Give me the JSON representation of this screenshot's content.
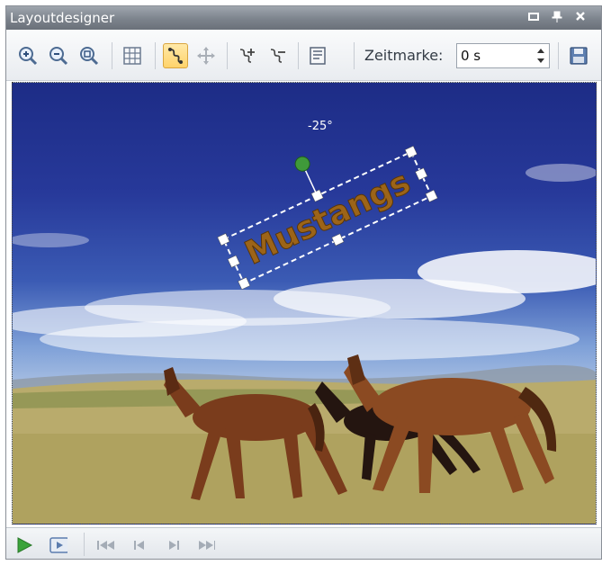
{
  "window": {
    "title": "Layoutdesigner"
  },
  "toolbar": {
    "zeit_label": "Zeitmarke:",
    "zeit_value": "0 s"
  },
  "canvas": {
    "text_object": "Mustangs",
    "rotation_label": "-25°"
  },
  "colors": {
    "titlebar": "#7c838c",
    "text_fill": "#9c6418",
    "active_tool": "#ffd36b",
    "play_green": "#3aa33a"
  },
  "icons": {
    "zoom_in": "magnifier-plus-icon",
    "zoom_out": "magnifier-minus-icon",
    "zoom_fit": "magnifier-fit-icon",
    "grid": "grid-icon",
    "motion_path": "motion-path-icon",
    "move": "move-arrows-icon",
    "add_point": "add-point-icon",
    "remove_point": "remove-point-icon",
    "properties": "properties-icon",
    "save": "save-icon",
    "play": "play-icon",
    "preview": "preview-icon",
    "first": "first-frame-icon",
    "prev": "previous-frame-icon",
    "next": "next-frame-icon",
    "last": "last-frame-icon"
  }
}
